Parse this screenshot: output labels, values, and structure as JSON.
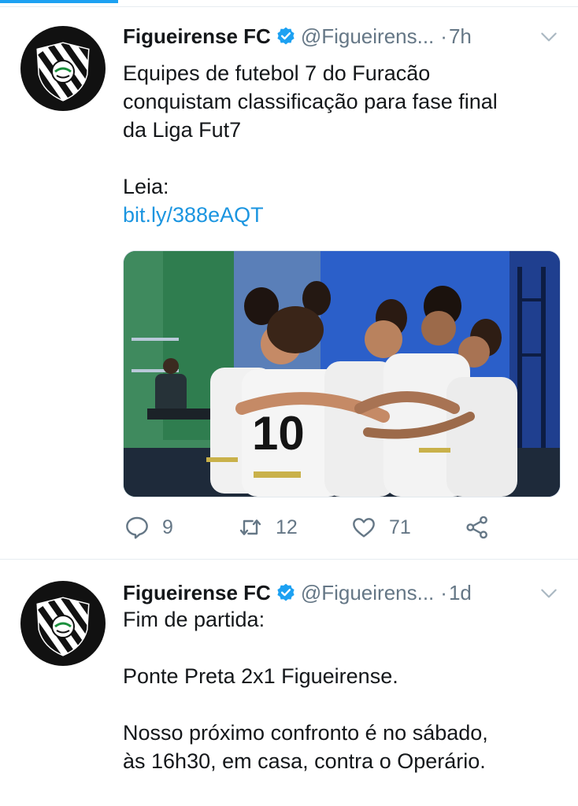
{
  "timeline": {
    "tweets": [
      {
        "display_name": "Figueirense FC",
        "handle": "@Figueirens...",
        "separator": "·",
        "time": "7h",
        "text_lines": [
          "Equipes de futebol 7 do Furacão",
          "conquistam classificação para fase final",
          "da Liga Fut7"
        ],
        "read_label": "Leia:",
        "link": "bit.ly/388eAQT",
        "actions": {
          "replies": "9",
          "retweets": "12",
          "likes": "71"
        }
      },
      {
        "display_name": "Figueirense FC",
        "handle": "@Figueirens...",
        "separator": "·",
        "time": "1d",
        "text_lines": [
          "Fim de partida:",
          "Ponte Preta 2x1 Figueirense.",
          "Nosso próximo confronto é no sábado,",
          "às 16h30, em casa, contra o Operário."
        ]
      }
    ]
  },
  "colors": {
    "accent": "#1da1f2",
    "link": "#1b95e0",
    "secondary_text": "#657786",
    "primary_text": "#14171a",
    "divider": "#e6ecf0"
  },
  "icons": {
    "verified": "verified-badge-icon",
    "caret": "chevron-down-icon",
    "reply": "reply-icon",
    "retweet": "retweet-icon",
    "like": "heart-icon",
    "share": "share-icon"
  }
}
